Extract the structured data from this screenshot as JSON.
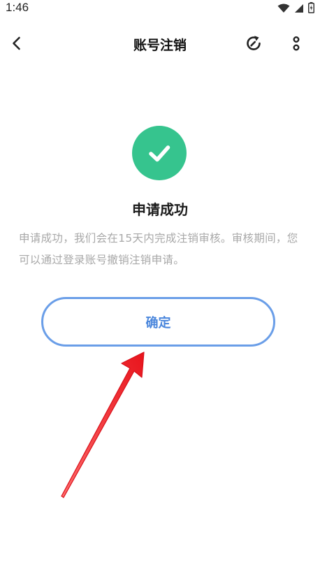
{
  "status_bar": {
    "time": "1:46"
  },
  "header": {
    "title": "账号注销",
    "back_icon": "chevron-left-icon",
    "refresh_icon": "refresh-icon",
    "more_icon": "more-vertical-icon"
  },
  "result": {
    "icon": "check-circle-icon",
    "title": "申请成功",
    "description": "申请成功，我们会在15天内完成注销审核。审核期间，您可以通过登录账号撤销注销申请。"
  },
  "confirm_button": {
    "label": "确定"
  },
  "colors": {
    "success": "#36c48e",
    "accent": "#4a86dc",
    "button_border": "#6a9ee8",
    "muted_text": "#a8a8a8",
    "annotation": "#e8141c"
  }
}
